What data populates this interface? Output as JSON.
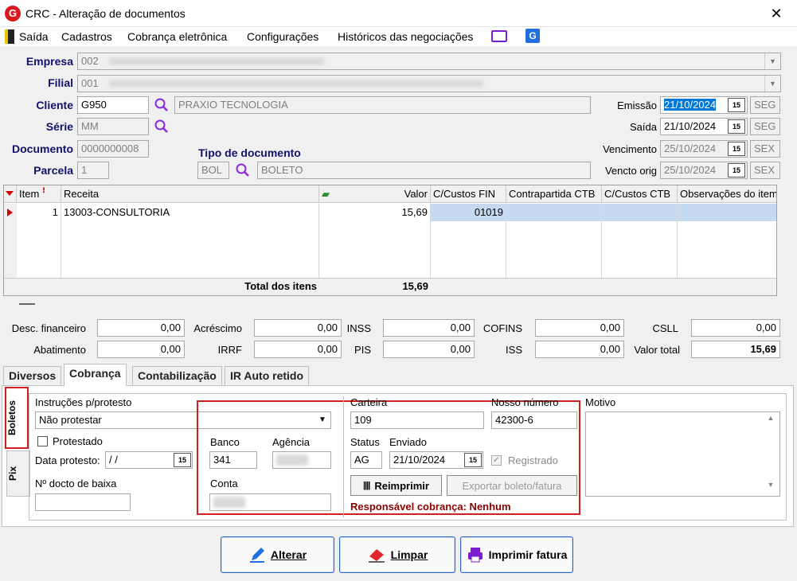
{
  "window": {
    "title": "CRC - Alteração de documentos",
    "close": "✕"
  },
  "menu": {
    "items": [
      "Saída",
      "Cadastros",
      "Cobrança eletrônica",
      "Configurações",
      "Históricos das negociações"
    ]
  },
  "header": {
    "empresa_label": "Empresa",
    "empresa_code": "002",
    "filial_label": "Filial",
    "filial_code": "001",
    "cliente_label": "Cliente",
    "cliente_code": "G950",
    "cliente_name": "PRAXIO TECNOLOGIA",
    "serie_label": "Série",
    "serie_value": "MM",
    "documento_label": "Documento",
    "documento_value": "0000000008",
    "parcela_label": "Parcela",
    "parcela_value": "1",
    "tipo_label": "Tipo de documento",
    "tipo_code": "BOL",
    "tipo_name": "BOLETO",
    "emissao_label": "Emissão",
    "emissao_date": "21/10/2024",
    "emissao_day": "SEG",
    "saida_label": "Saída",
    "saida_date": "21/10/2024",
    "saida_day": "SEG",
    "vencimento_label": "Vencimento",
    "vencimento_date": "25/10/2024",
    "vencimento_day": "SEX",
    "vencto_orig_label": "Vencto orig",
    "vencto_orig_date": "25/10/2024",
    "vencto_orig_day": "SEX"
  },
  "items_grid": {
    "columns": [
      "Item",
      "Receita",
      "Valor",
      "C/Custos FIN",
      "Contrapartida CTB",
      "C/Custos CTB",
      "Observações do item"
    ],
    "rows": [
      {
        "item": "1",
        "receita": "13003-CONSULTORIA",
        "valor": "15,69",
        "ccustos_fin": "01019",
        "contrapartida": "",
        "ccustos_ctb": "",
        "obs": ""
      }
    ],
    "total_label": "Total dos itens",
    "total_value": "15,69"
  },
  "totals": {
    "desc_fin_label": "Desc. financeiro",
    "desc_fin": "0,00",
    "acrescimo_label": "Acréscimo",
    "acrescimo": "0,00",
    "inss_label": "INSS",
    "inss": "0,00",
    "cofins_label": "COFINS",
    "cofins": "0,00",
    "csll_label": "CSLL",
    "csll": "0,00",
    "abatimento_label": "Abatimento",
    "abatimento": "0,00",
    "irrf_label": "IRRF",
    "irrf": "0,00",
    "pis_label": "PIS",
    "pis": "0,00",
    "iss_label": "ISS",
    "iss": "0,00",
    "valor_total_label": "Valor total",
    "valor_total": "15,69"
  },
  "tabs": [
    "Diversos",
    "Cobrança",
    "Contabilização",
    "IR Auto retido"
  ],
  "side_tabs": [
    "Boletos",
    "Pix"
  ],
  "boletos": {
    "instrucoes_label": "Instruções p/protesto",
    "instrucoes_value": "Não protestar",
    "protestado_label": "Protestado",
    "data_protesto_label": "Data protesto:",
    "data_protesto_value": " / /",
    "docto_baixa_label": "Nº docto de baixa",
    "docto_baixa_value": "",
    "banco_label": "Banco",
    "banco_value": "341",
    "agencia_label": "Agência",
    "conta_label": "Conta",
    "carteira_label": "Carteira",
    "carteira_value": "109",
    "nosso_numero_label": "Nosso número",
    "nosso_numero_value": "42300-6",
    "status_label": "Status",
    "status_value": "AG",
    "enviado_label": "Enviado",
    "enviado_value": "21/10/2024",
    "registrado_label": "Registrado",
    "reimprimir_label": "Reimprimir",
    "exportar_label": "Exportar boleto/fatura",
    "responsavel_text": "Responsável cobrança: Nenhum",
    "motivo_label": "Motivo"
  },
  "actions": {
    "alterar": "Alterar",
    "limpar": "Limpar",
    "imprimir": "Imprimir fatura"
  },
  "colors": {
    "accent_red": "#d21f1f",
    "label_blue": "#12126b",
    "selection_blue": "#0078d7",
    "row_highlight": "#c5d9f1",
    "dark_red_text": "#8b0000"
  }
}
